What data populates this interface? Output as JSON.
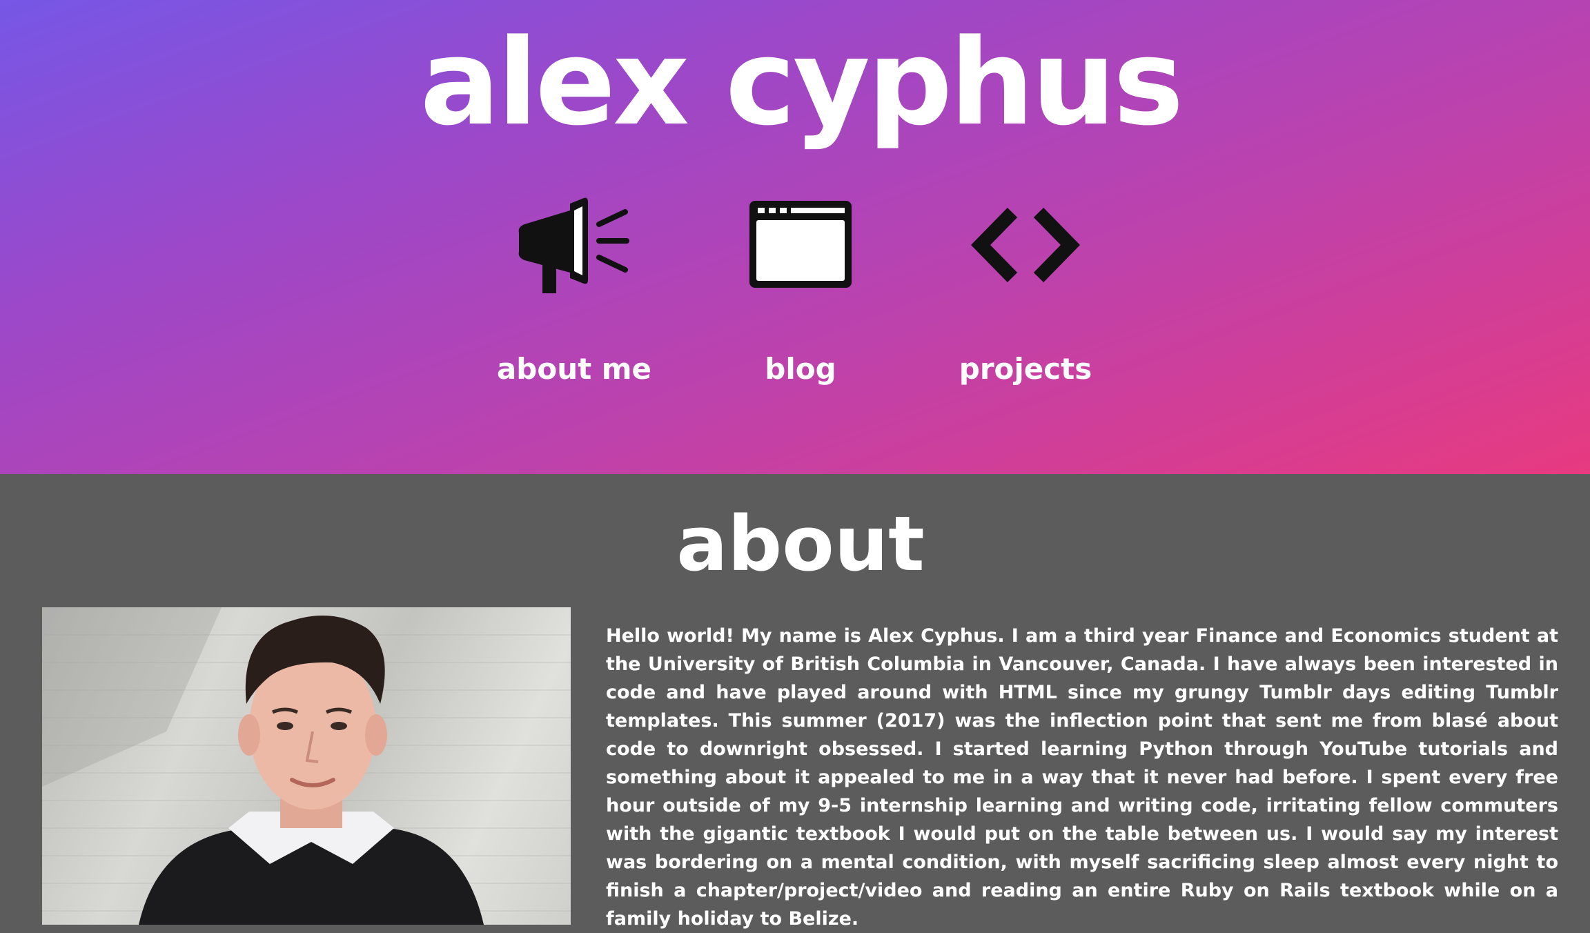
{
  "header": {
    "title": "alex cyphus"
  },
  "nav": {
    "items": [
      {
        "label": "about me",
        "icon": "megaphone-icon"
      },
      {
        "label": "blog",
        "icon": "browser-window-icon"
      },
      {
        "label": "projects",
        "icon": "code-brackets-icon"
      }
    ]
  },
  "about": {
    "heading": "about",
    "photo": "portrait-photo",
    "bio": "Hello world! My name is Alex Cyphus. I am a third year Finance and Economics student at the University of British Columbia in Vancouver, Canada. I have always been interested in code and have played around with HTML since my grungy Tumblr days editing Tumblr templates. This summer (2017) was the inflection point that sent me from blasé about code to downright obsessed. I started learning Python through YouTube tutorials and something about it appealed to me in a way that it never had before. I spent every free hour outside of my 9-5 internship learning and writing code, irritating fellow commuters with the gigantic textbook I would put on the table between us. I would say my interest was bordering on a mental condition, with myself sacrificing sleep almost every night to finish a chapter/project/video and reading an entire Ruby on Rails textbook while on a family holiday to Belize."
  },
  "colors": {
    "gradient_start": "#7657e6",
    "gradient_end": "#e73a80",
    "about_background": "#5c5c5c",
    "text": "#ffffff",
    "icon": "#111111"
  }
}
